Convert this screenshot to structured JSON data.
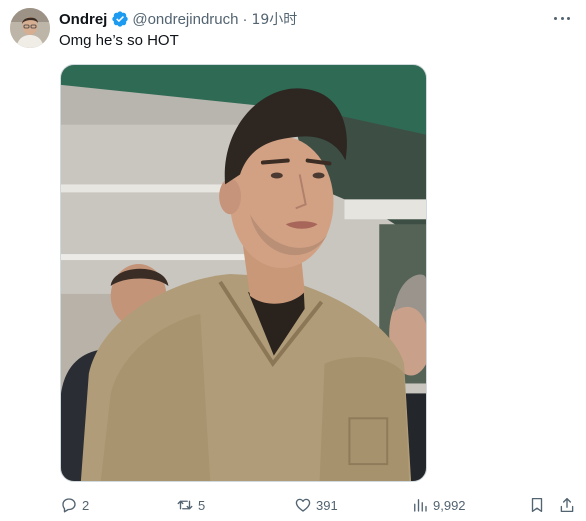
{
  "tweet": {
    "author": {
      "display_name": "Ondrej",
      "handle": "@ondrejindruch",
      "verified": true,
      "avatar_icon": "profile-avatar"
    },
    "separator": "·",
    "timestamp": "19小时",
    "text": "Omg he’s so HOT",
    "more_icon": "more-options-icon",
    "media": {
      "type": "photo"
    }
  },
  "actions": {
    "reply_count": "2",
    "retweet_count": "5",
    "like_count": "391",
    "view_count": "9,992"
  },
  "colors": {
    "verified": "#1d9bf0",
    "secondary_text": "#536471",
    "primary_text": "#0f1419",
    "border": "#cfd9de"
  }
}
